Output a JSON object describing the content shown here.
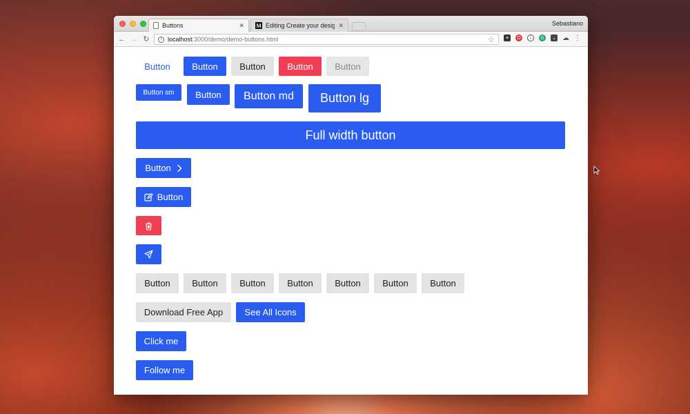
{
  "browser": {
    "tabs": [
      {
        "title": "Buttons",
        "active": true
      },
      {
        "title": "Editing Create your design sys",
        "active": false
      }
    ],
    "profile_name": "Sebastiano",
    "url_host": "localhost",
    "url_path": ":3000/demo/demo-buttons.html"
  },
  "buttons": {
    "row1": [
      "Button",
      "Button",
      "Button",
      "Button",
      "Button"
    ],
    "sizes": [
      "Button sm",
      "Button",
      "Button md",
      "Button lg"
    ],
    "full_width": "Full width button",
    "icon_right": "Button",
    "icon_left": "Button",
    "gray_row": [
      "Button",
      "Button",
      "Button",
      "Button",
      "Button",
      "Button",
      "Button"
    ],
    "download": "Download Free App",
    "see_all": "See All Icons",
    "click_me": "Click me",
    "follow_me": "Follow me"
  },
  "colors": {
    "primary": "#2a5cf0",
    "danger": "#f03e52",
    "secondary": "#e3e3e3"
  }
}
